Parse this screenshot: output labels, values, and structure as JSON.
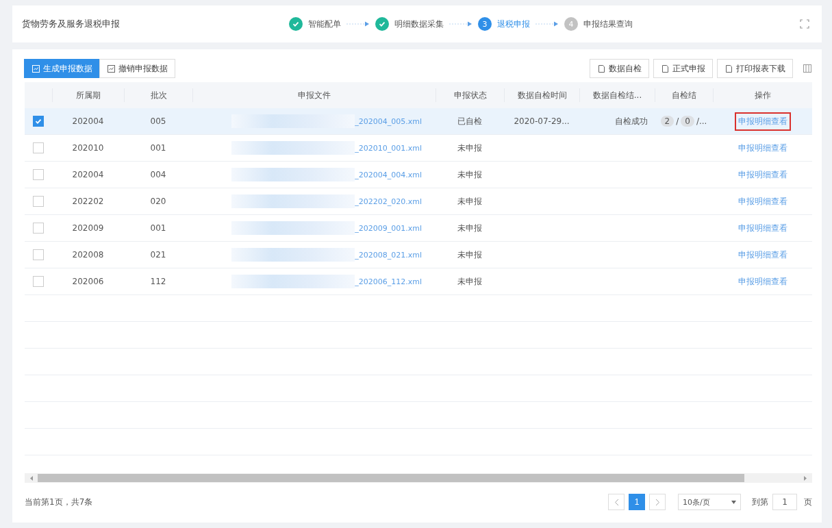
{
  "header": {
    "title": "货物劳务及服务退税申报",
    "steps": [
      {
        "label": "智能配单",
        "done": true,
        "selected": false
      },
      {
        "label": "明细数据采集",
        "done": true,
        "selected": false
      },
      {
        "label": "退税申报",
        "done": false,
        "selected": true,
        "number": "3"
      },
      {
        "label": "申报结果查询",
        "done": false,
        "selected": false,
        "number": "4"
      }
    ]
  },
  "toolbar": {
    "left_buttons": [
      {
        "label": "生成申报数据",
        "primary": true
      },
      {
        "label": "撤销申报数据",
        "primary": false
      }
    ],
    "right_buttons": [
      "数据自检",
      "正式申报",
      "打印报表下载"
    ]
  },
  "table": {
    "columns": [
      "所属期",
      "批次",
      "申报文件",
      "申报状态",
      "数据自检时间",
      "数据自检结...",
      "自检结",
      "操作"
    ],
    "rows": [
      {
        "selected": true,
        "period": "202004",
        "batch": "005",
        "file": "_202004_005.xml",
        "status": "已自检",
        "check_time": "2020-07-29...",
        "check_result": "自检成功",
        "counts": [
          "2",
          "0"
        ],
        "separators": [
          "/",
          "/..."
        ],
        "action": "申报明细查看",
        "highlighted": true
      },
      {
        "selected": false,
        "period": "202010",
        "batch": "001",
        "file": "_202010_001.xml",
        "status": "未申报",
        "action": "申报明细查看",
        "highlighted": false
      },
      {
        "selected": false,
        "period": "202004",
        "batch": "004",
        "file": "_202004_004.xml",
        "status": "未申报",
        "action": "申报明细查看",
        "highlighted": false
      },
      {
        "selected": false,
        "period": "202202",
        "batch": "020",
        "file": "_202202_020.xml",
        "status": "未申报",
        "action": "申报明细查看",
        "highlighted": false
      },
      {
        "selected": false,
        "period": "202009",
        "batch": "001",
        "file": "_202009_001.xml",
        "status": "未申报",
        "action": "申报明细查看",
        "highlighted": false
      },
      {
        "selected": false,
        "period": "202008",
        "batch": "021",
        "file": "_202008_021.xml",
        "status": "未申报",
        "action": "申报明细查看",
        "highlighted": false
      },
      {
        "selected": false,
        "period": "202006",
        "batch": "112",
        "file": "_202006_112.xml",
        "status": "未申报",
        "action": "申报明细查看",
        "highlighted": false
      }
    ]
  },
  "footer": {
    "summary": "当前第1页，共7条",
    "pages": [
      {
        "label": "1",
        "selected": true
      }
    ],
    "page_size": "10条/页",
    "goto_label": "到第",
    "goto_value": "1",
    "goto_suffix": "页"
  }
}
